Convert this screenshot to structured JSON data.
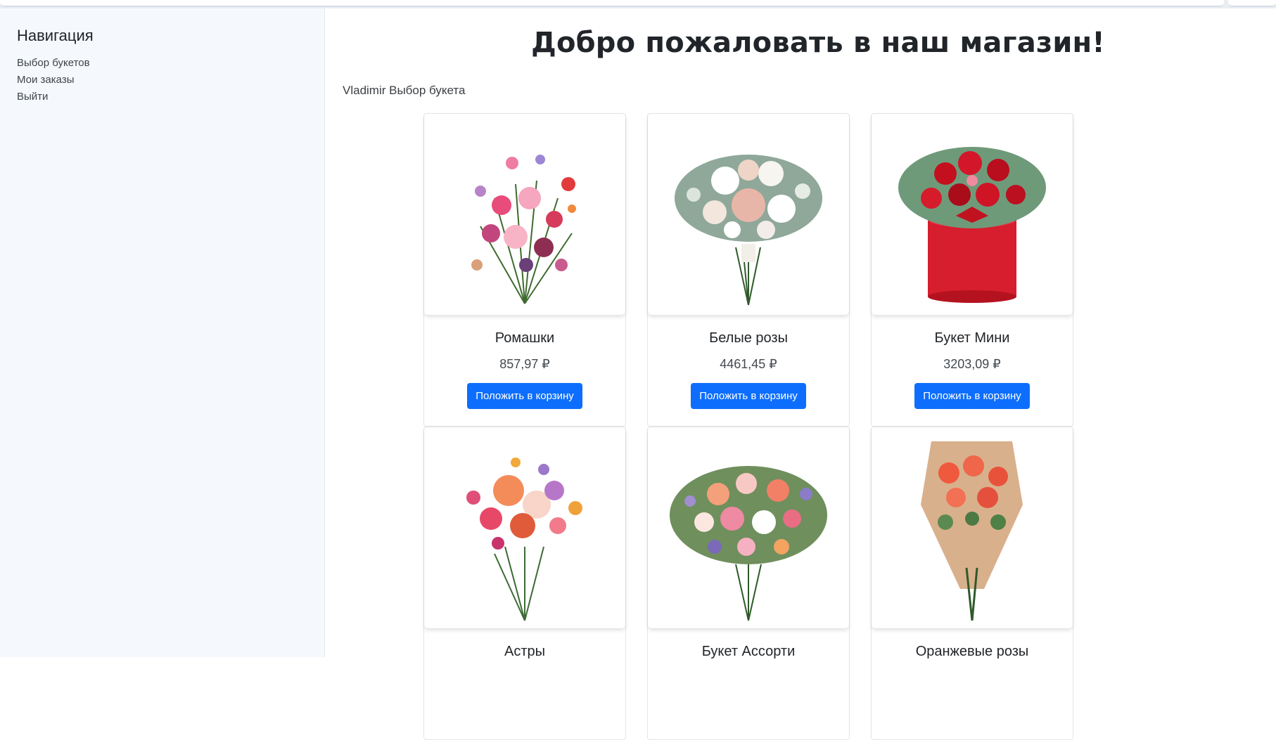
{
  "sidebar": {
    "title": "Навигация",
    "items": [
      {
        "label": "Выбор букетов"
      },
      {
        "label": "Мои заказы"
      },
      {
        "label": "Выйти"
      }
    ]
  },
  "main": {
    "heading": "Добро пожаловать в наш магазин!",
    "subtitle": "Vladimir Выбор букета"
  },
  "products": [
    {
      "name": "Ромашки",
      "price": "857,97 ₽",
      "button": "Положить в корзину",
      "image": "wildflower-bouquet-image"
    },
    {
      "name": "Белые розы",
      "price": "4461,45 ₽",
      "button": "Положить в корзину",
      "image": "white-roses-bouquet-image"
    },
    {
      "name": "Букет Мини",
      "price": "3203,09 ₽",
      "button": "Положить в корзину",
      "image": "red-roses-box-image"
    },
    {
      "name": "Астры",
      "image": "asters-bouquet-image"
    },
    {
      "name": "Букет Ассорти",
      "image": "assorted-bouquet-image"
    },
    {
      "name": "Оранжевые розы",
      "image": "orange-roses-bouquet-image"
    }
  ],
  "colors": {
    "accent": "#0d6efd",
    "sidebar_bg": "#f5f9fd"
  }
}
